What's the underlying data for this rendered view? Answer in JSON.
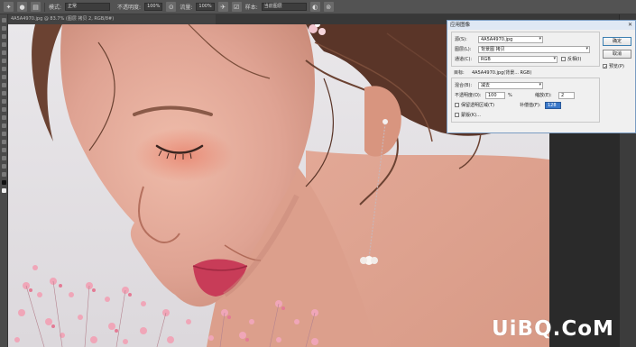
{
  "options_bar": {
    "mode_label": "模式:",
    "mode_value": "正常",
    "opacity_label": "不透明度:",
    "opacity_value": "100%",
    "flow_label": "流量:",
    "flow_value": "100%",
    "sample_label": "样本:",
    "sample_value": "当前图层"
  },
  "document_tab": {
    "title": "4A5A4970.jpg @ 83.7% (图层 拷贝 2, RGB/8#)"
  },
  "dialog": {
    "title": "应用图像",
    "source_label": "源(S):",
    "source_value": "4A5A4970.jpg",
    "layer_label": "图层(L):",
    "layer_value": "背景图 拷贝",
    "channel_label": "通道(C):",
    "channel_value": "RGB",
    "invert_label": "反相(I)",
    "target_label": "目标:",
    "target_value": "4A5A4970.jpg(背景...  RGB)",
    "blending_label": "混合(B):",
    "blending_value": "减去",
    "opacity_label": "不透明度(O):",
    "opacity_value": "100",
    "opacity_unit": "%",
    "scale_label": "缩放(E):",
    "scale_value": "2",
    "offset_label": "补偿值(F):",
    "offset_value": "128",
    "preserve_label": "保留透明区域(T)",
    "mask_label": "蒙版(K)...",
    "ok_label": "确定",
    "cancel_label": "取消",
    "preview_label": "预览(P)"
  },
  "watermark": "UiBQ.CoM",
  "colors": {
    "dialog_border": "#7a9cc2",
    "canvas_bg": "#e9e6e8",
    "skin": "#dfa393",
    "lips": "#c83c58",
    "hair": "#5a3528"
  }
}
